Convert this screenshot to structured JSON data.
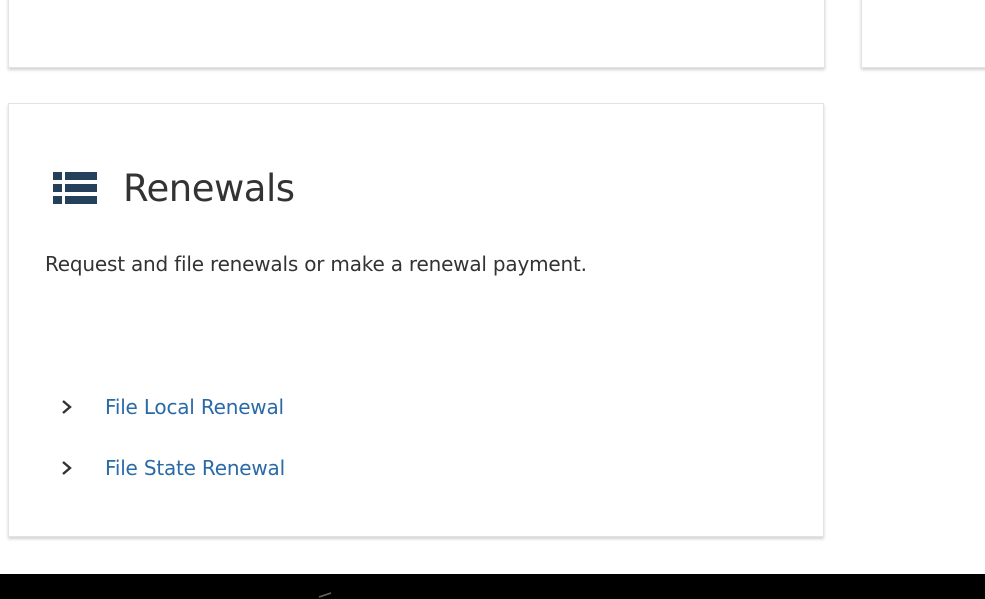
{
  "renewals_card": {
    "title": "Renewals",
    "icon": "list-icon",
    "description": "Request and file renewals or make a renewal payment.",
    "links": [
      {
        "label": "File Local Renewal",
        "icon": "chevron-right-icon"
      },
      {
        "label": "File State Renewal",
        "icon": "chevron-right-icon"
      }
    ]
  },
  "colors": {
    "title_text": "#333333",
    "link_text": "#2a6aa8",
    "icon": "#24405a",
    "footer_bar": "#000000"
  }
}
